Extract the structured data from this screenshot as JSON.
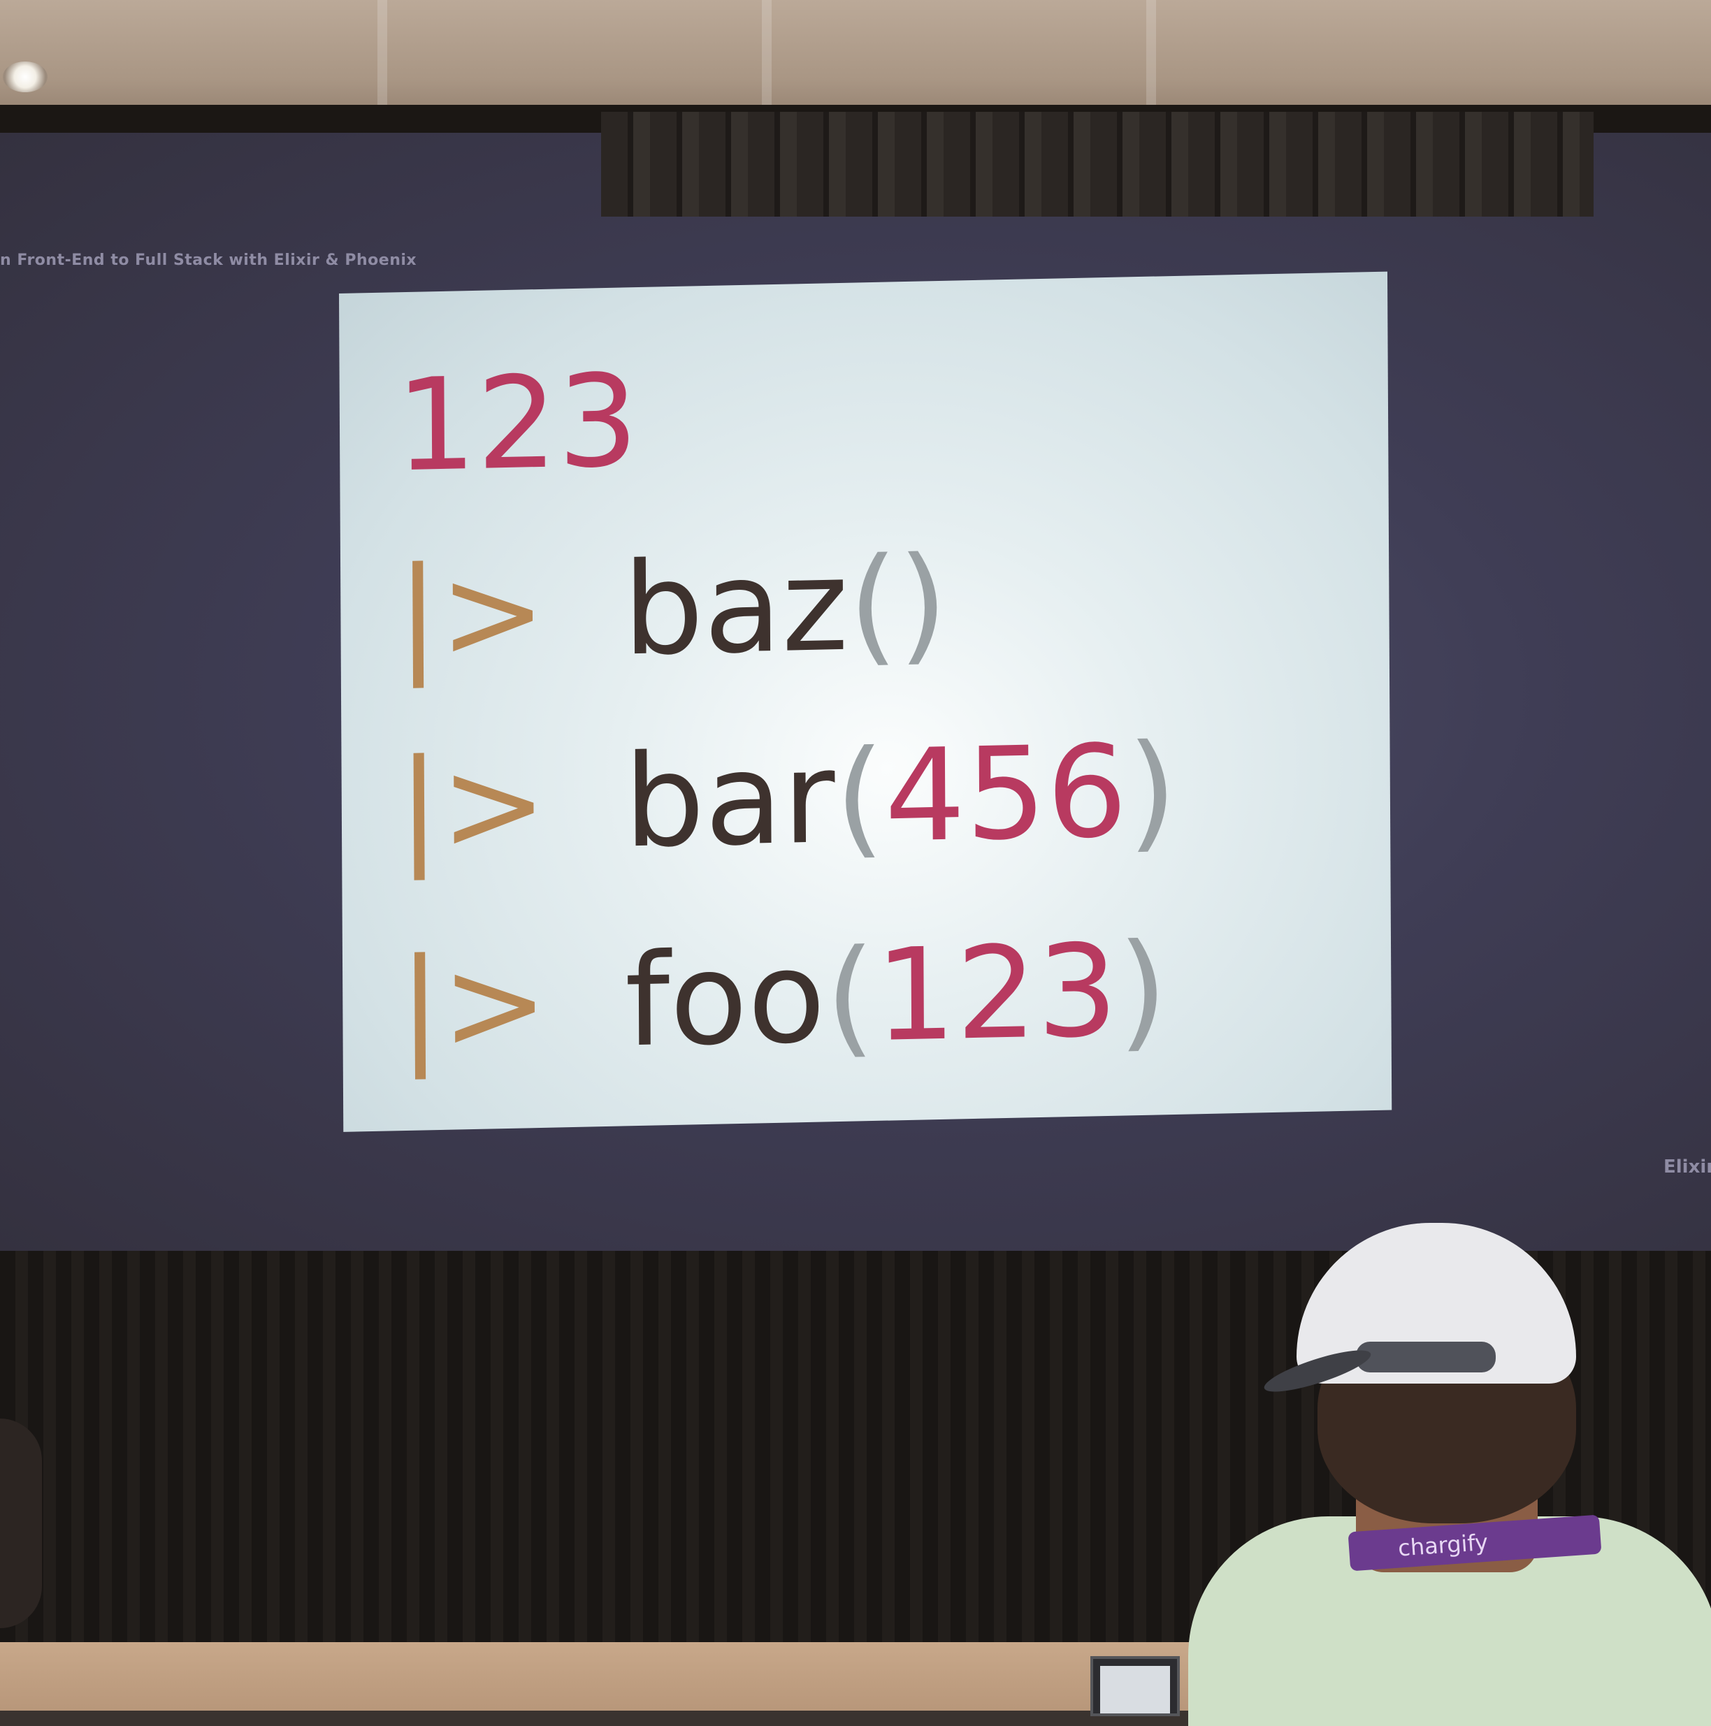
{
  "slide": {
    "header": "n Front-End to Full Stack with Elixir & Phoenix",
    "footer": "Elixir",
    "code": {
      "initial": "123",
      "pipe_op": "|>",
      "lines": [
        {
          "fn": "baz",
          "open": "(",
          "arg": "",
          "close": ")"
        },
        {
          "fn": "bar",
          "open": "(",
          "arg": "456",
          "close": ")"
        },
        {
          "fn": "foo",
          "open": "(",
          "arg": "123",
          "close": ")"
        }
      ]
    },
    "colors": {
      "number": "#b83a60",
      "pipe": "#b78855",
      "function": "#3e322e",
      "paren": "#9aa1a4",
      "slide_bg": "#e6eff1"
    }
  },
  "audience": {
    "lanyard_text": "chargify"
  }
}
